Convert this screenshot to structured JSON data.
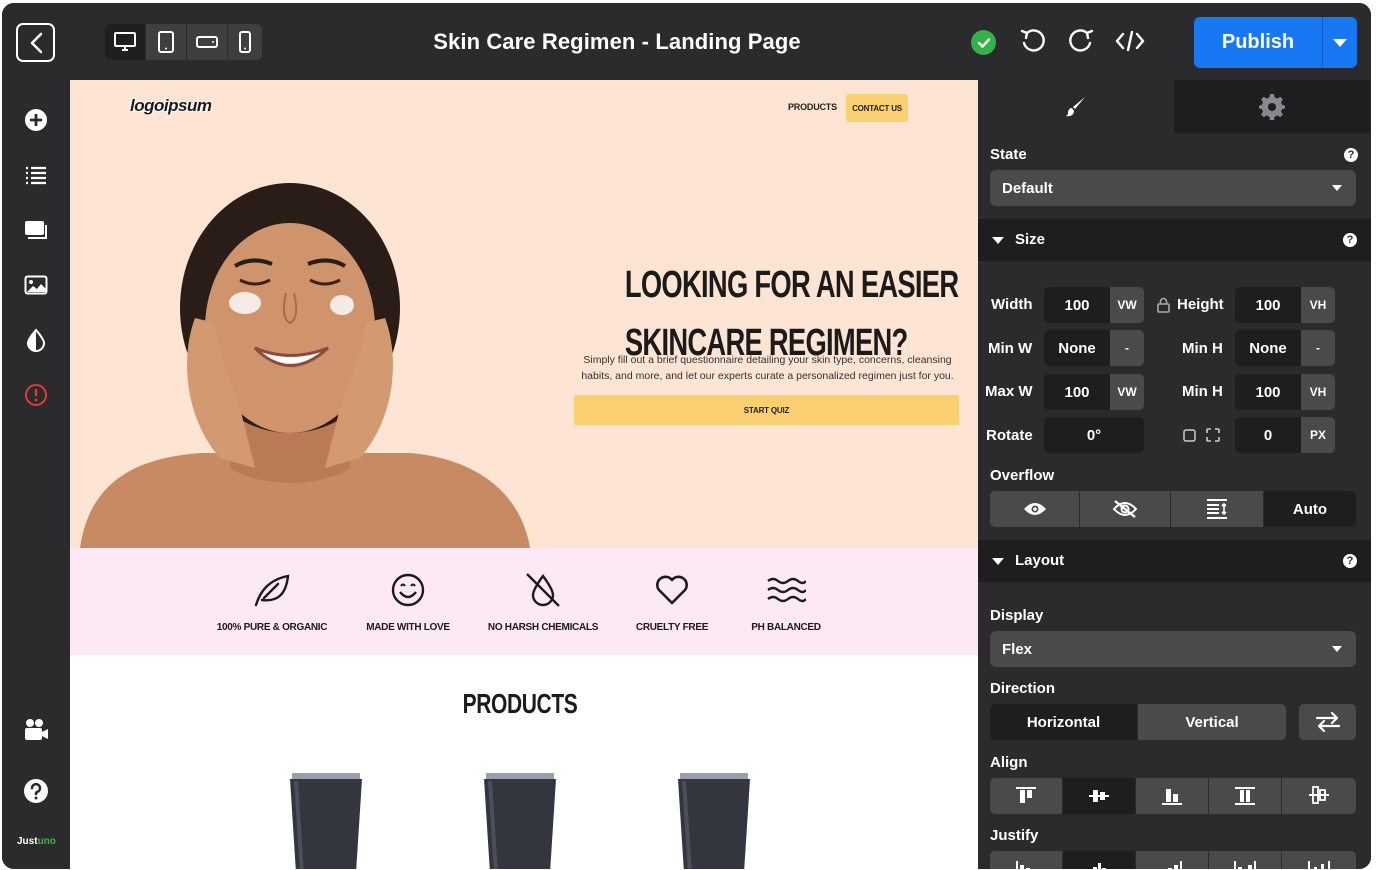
{
  "header": {
    "title": "Skin Care Regimen - Landing Page",
    "publish_label": "Publish",
    "devices": [
      "desktop-icon",
      "tablet-icon",
      "tablet-landscape-icon",
      "mobile-icon"
    ]
  },
  "left_sidebar": {
    "items": [
      "add-icon",
      "layers-icon",
      "pages-icon",
      "image-icon",
      "contrast-icon",
      "alert-icon",
      "video-icon",
      "help-icon"
    ],
    "brand": "Just",
    "brand_accent": "uno"
  },
  "site": {
    "logo": "logoipsum",
    "nav_products": "PRODUCTS",
    "nav_contact": "CONTACT US",
    "heading_line1": "LOOKING FOR AN EASIER",
    "heading_line2": "SKINCARE REGIMEN?",
    "body": "Simply fill out a brief questionnaire detailing your skin type, concerns, cleansing habits, and more, and let our experts curate a personalized regimen just for you.",
    "cta": "START QUIZ",
    "features": [
      {
        "label": "100% PURE & ORGANIC",
        "icon": "leaf-icon"
      },
      {
        "label": "MADE WITH LOVE",
        "icon": "smile-icon"
      },
      {
        "label": "NO HARSH CHEMICALS",
        "icon": "no-drop-icon"
      },
      {
        "label": "CRUELTY FREE",
        "icon": "heart-icon"
      },
      {
        "label": "PH BALANCED",
        "icon": "waves-icon"
      }
    ],
    "products_title": "PRODUCTS",
    "colors": {
      "hero_bg": "#fde4d3",
      "feature_bg": "#fde8f6",
      "accent": "#fbd071"
    }
  },
  "panel": {
    "state_label": "State",
    "state_value": "Default",
    "size_section": "Size",
    "width_label": "Width",
    "width_value": "100",
    "width_unit": "VW",
    "height_label": "Height",
    "height_value": "100",
    "height_unit": "VH",
    "minw_label": "Min W",
    "minw_value": "None",
    "minw_unit": "-",
    "minh_label": "Min H",
    "minh_value": "None",
    "minh_unit": "-",
    "maxw_label": "Max W",
    "maxw_value": "100",
    "maxw_unit": "VW",
    "maxh_label": "Min H",
    "maxh_value": "100",
    "maxh_unit": "VH",
    "rotate_label": "Rotate",
    "rotate_value": "0°",
    "radius_value": "0",
    "radius_unit": "PX",
    "overflow_label": "Overflow",
    "overflow_auto": "Auto",
    "layout_section": "Layout",
    "display_label": "Display",
    "display_value": "Flex",
    "direction_label": "Direction",
    "direction_horizontal": "Horizontal",
    "direction_vertical": "Vertical",
    "align_label": "Align",
    "justify_label": "Justify",
    "help": "?"
  }
}
